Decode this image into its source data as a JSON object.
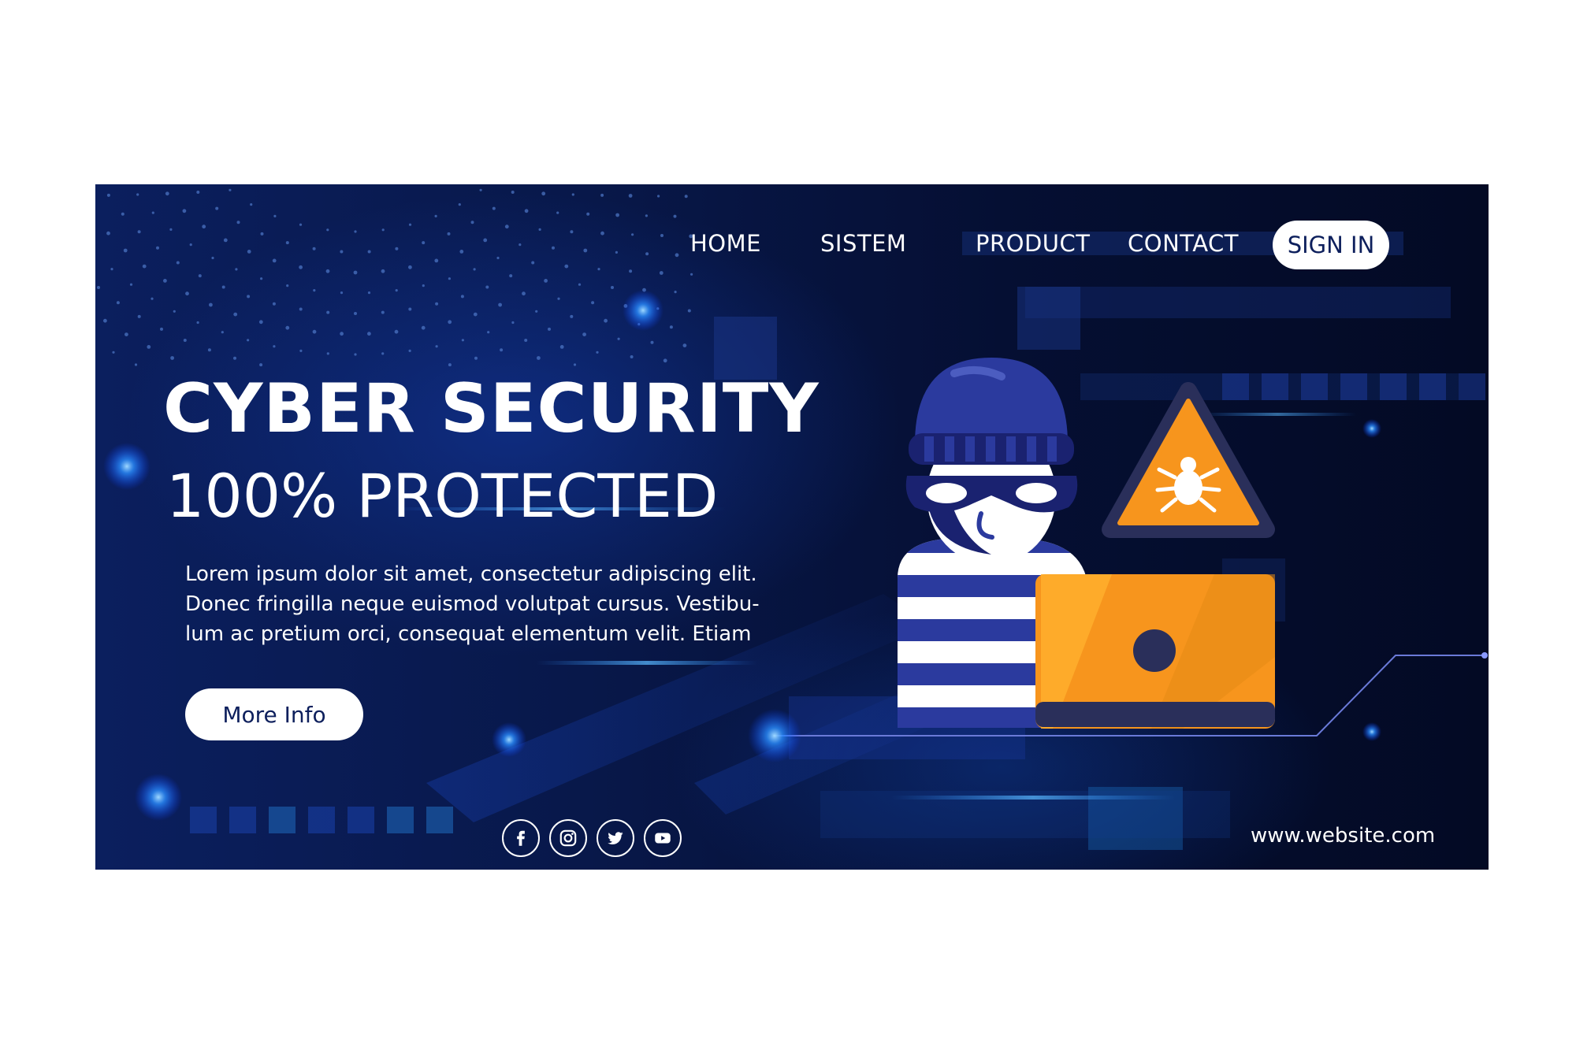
{
  "nav": {
    "home": "HOME",
    "sistem": "SISTEM",
    "product": "PRODUCT",
    "contact": "CONTACT",
    "signin": "SIGN IN"
  },
  "hero": {
    "title": "CYBER SECURITY",
    "subtitle": "100% PROTECTED",
    "body_lines": [
      "Lorem ipsum dolor sit amet, consectetur adipiscing elit.",
      "Donec fringilla neque euismod volutpat cursus. Vestibu-",
      "lum ac pretium orci, consequat elementum velit. Etiam"
    ],
    "button": "More Info"
  },
  "footer": {
    "website": "www.website.com",
    "social_icons": [
      "facebook-icon",
      "instagram-icon",
      "twitter-icon",
      "youtube-icon"
    ]
  },
  "colors": {
    "background_dark": "#050f33",
    "accent_blue": "#1a5cff",
    "warning_orange": "#f7951d",
    "hacker_navy": "#2b3a9e"
  }
}
